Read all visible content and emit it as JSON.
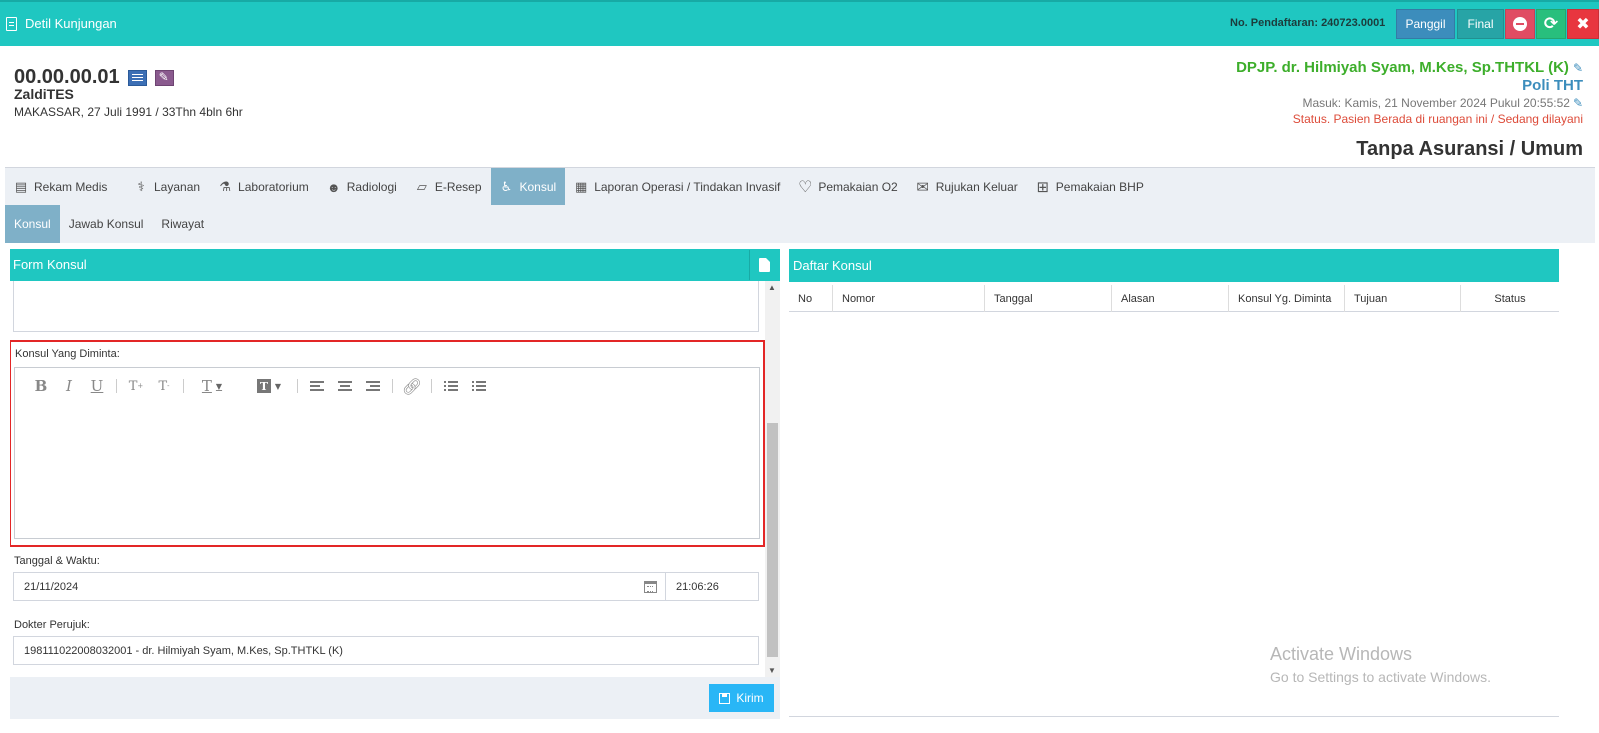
{
  "topbar": {
    "title": "Detil Kunjungan",
    "registration": "No. Pendaftaran: 240723.0001",
    "panggil_label": "Panggil",
    "final_label": "Final",
    "close_glyph": "✖",
    "refresh_glyph": "⟳",
    "colors": {
      "bar": "#1fc7c1",
      "panggil": "#3c8dbc",
      "final": "#27a4a6",
      "minus": "#e04c63",
      "refresh": "#28bf7d",
      "close": "#e8363f"
    }
  },
  "patient": {
    "id": "00.00.00.01",
    "name": "ZaldiTES",
    "birth": "MAKASSAR, 27 Juli 1991 / 33Thn 4bln 6hr"
  },
  "visit": {
    "dpjp": "DPJP. dr. Hilmiyah Syam, M.Kes, Sp.THTKL (K)",
    "poli": "Poli THT",
    "masuk": "Masuk: Kamis, 21 November 2024 Pukul 20:55:52",
    "status": "Status. Pasien Berada di ruangan ini / Sedang dilayani",
    "asuransi": "Tanpa Asuransi / Umum",
    "edit_glyph": "✎"
  },
  "tabs": [
    {
      "label": "Rekam Medis",
      "icon": "document-icon",
      "glyph": "▤"
    },
    {
      "label": "Layanan",
      "icon": "user-md-icon",
      "glyph": "⚕"
    },
    {
      "label": "Laboratorium",
      "icon": "flask-icon",
      "glyph": "⚗"
    },
    {
      "label": "Radiologi",
      "icon": "id-badge-icon",
      "glyph": "☻"
    },
    {
      "label": "E-Resep",
      "icon": "eraser-icon",
      "glyph": "▱"
    },
    {
      "label": "Konsul",
      "icon": "wheelchair-icon",
      "glyph": "♿",
      "active": true
    },
    {
      "label": "Laporan Operasi / Tindakan Invasif",
      "icon": "newspaper-icon",
      "glyph": "▦"
    },
    {
      "label": "Pemakaian O2",
      "icon": "heart-icon",
      "glyph": "♡"
    },
    {
      "label": "Rujukan Keluar",
      "icon": "envelope-icon",
      "glyph": "✉"
    },
    {
      "label": "Pemakaian BHP",
      "icon": "medkit-icon",
      "glyph": "⊞"
    }
  ],
  "subtabs": [
    {
      "label": "Konsul",
      "active": true
    },
    {
      "label": "Jawab Konsul"
    },
    {
      "label": "Riwayat"
    }
  ],
  "form": {
    "title": "Form Konsul",
    "konsul_label": "Konsul Yang Diminta:",
    "editor_content": "",
    "toolbar": {
      "bold": "B",
      "italic": "I",
      "underline": "U",
      "superscript": "T",
      "subscript": "T",
      "text_color": "T",
      "highlight": "T"
    },
    "tanggal_label": "Tanggal & Waktu:",
    "date_value": "21/11/2024",
    "time_value": "21:06:26",
    "dokter_label": "Dokter Perujuk:",
    "dokter_value": "198111022008032001 - dr. Hilmiyah Syam, M.Kes, Sp.THTKL (K)",
    "kirim_label": "Kirim"
  },
  "daftar": {
    "title": "Daftar Konsul",
    "columns": [
      "No",
      "Nomor",
      "Tanggal",
      "Alasan",
      "Konsul Yg. Diminta",
      "Tujuan",
      "Status"
    ],
    "rows": []
  },
  "watermark": {
    "line1": "Activate Windows",
    "line2": "Go to Settings to activate Windows."
  }
}
